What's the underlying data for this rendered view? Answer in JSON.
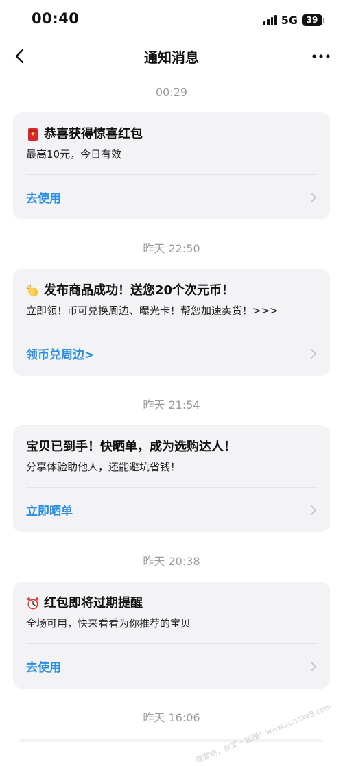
{
  "status_bar": {
    "time": "00:40",
    "network": "5G",
    "battery": "39"
  },
  "nav": {
    "title": "通知消息"
  },
  "groups": [
    {
      "timestamp": "00:29",
      "icon": "red-envelope-icon",
      "title": "恭喜获得惊喜红包",
      "desc": "最高10元，今日有效",
      "action": "去使用"
    },
    {
      "timestamp": "昨天 22:50",
      "icon": "clapping-hands-icon",
      "title": "发布商品成功！送您20个次元币！",
      "desc": "立即领！币可兑换周边、曝光卡！帮您加速卖货！>>>",
      "action": "领币兑周边>"
    },
    {
      "timestamp": "昨天 21:54",
      "icon": "",
      "title": "宝贝已到手！快晒单，成为选购达人！",
      "desc": "分享体验助他人，还能避坑省钱！",
      "action": "立即晒单"
    },
    {
      "timestamp": "昨天 20:38",
      "icon": "alarm-clock-icon",
      "title": "红包即将过期提醒",
      "desc": "全场可用，快来看看为你推荐的宝贝",
      "action": "去使用"
    },
    {
      "timestamp": "昨天 16:06"
    }
  ],
  "watermark": "赚客吧，有奖一起赚！www.zuanke8.com",
  "colors": {
    "accent": "#2a8fe0",
    "card_bg": "#f3f3f5",
    "timestamp": "#9b9b9b"
  }
}
